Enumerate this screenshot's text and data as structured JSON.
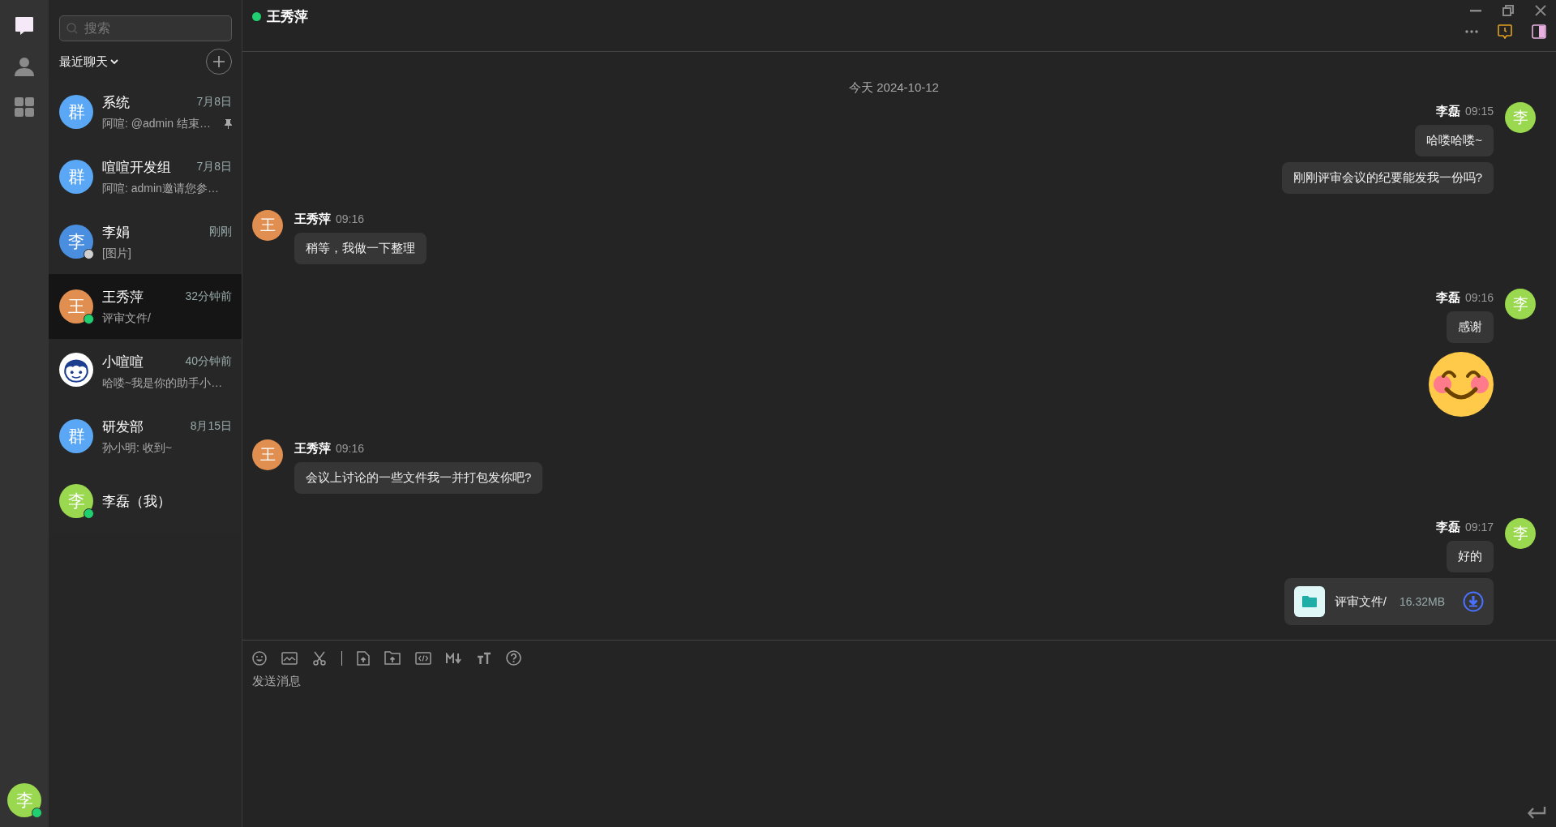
{
  "rail": {
    "items": [
      {
        "kind": "chat",
        "selected": true
      },
      {
        "kind": "contacts",
        "selected": false
      },
      {
        "kind": "apps",
        "selected": false
      }
    ],
    "me": {
      "text": "李",
      "color": "#9ad94f",
      "status_dot": {
        "color": "#20d070"
      }
    }
  },
  "sidebar": {
    "search": {
      "placeholder": "搜索"
    },
    "filter": "最近聊天",
    "conversations": [
      {
        "name": "系统",
        "time": "7月8日",
        "preview": "阿喧: @admin 结束…",
        "avatar": {
          "kind": "text",
          "text": "群",
          "color": "#5aa8f5"
        },
        "pinned": true,
        "selected": false
      },
      {
        "name": "喧喧开发组",
        "time": "7月8日",
        "preview": "阿喧: admin邀请您参…",
        "avatar": {
          "kind": "text",
          "text": "群",
          "color": "#5aa8f5"
        },
        "pinned": false,
        "selected": false
      },
      {
        "name": "李娟",
        "time": "刚刚",
        "preview": "[图片]",
        "avatar": {
          "kind": "text",
          "text": "李",
          "color": "#4a8ee0"
        },
        "status_dot": {
          "color": "#cfcfcf"
        },
        "pinned": false,
        "selected": false
      },
      {
        "name": "王秀萍",
        "time": "32分钟前",
        "preview": "评审文件/",
        "avatar": {
          "kind": "text",
          "text": "王",
          "color": "#e08f50"
        },
        "status_dot": {
          "color": "#20d070"
        },
        "pinned": false,
        "selected": true
      },
      {
        "name": "小喧喧",
        "time": "40分钟前",
        "preview": "哈喽~我是你的助手小…",
        "avatar": {
          "kind": "mascot"
        },
        "pinned": false,
        "selected": false
      },
      {
        "name": "研发部",
        "time": "8月15日",
        "preview": "孙小明: 收到~",
        "avatar": {
          "kind": "text",
          "text": "群",
          "color": "#5aa8f5"
        },
        "pinned": false,
        "selected": false
      },
      {
        "name": "李磊（我）",
        "avatar": {
          "kind": "text",
          "text": "李",
          "color": "#9ad94f"
        },
        "status_dot": {
          "color": "#20d070"
        },
        "pinned": false,
        "selected": false
      }
    ]
  },
  "chat": {
    "title": "王秀萍",
    "online": true,
    "messages": [
      {
        "kind": "date",
        "text": "今天 2024-10-12"
      },
      {
        "kind": "sent",
        "sender": "李磊",
        "time": "09:15",
        "avatar": {
          "text": "李",
          "color": "#9ad94f"
        },
        "items": [
          {
            "kind": "text",
            "text": "哈喽哈喽~"
          },
          {
            "kind": "text",
            "text": "刚刚评审会议的纪要能发我一份吗?"
          }
        ]
      },
      {
        "kind": "received",
        "sender": "王秀萍",
        "time": "09:16",
        "avatar": {
          "text": "王",
          "color": "#e08f50"
        },
        "items": [
          {
            "kind": "text",
            "text": "稍等，我做一下整理"
          }
        ]
      },
      {
        "kind": "sent",
        "sender": "李磊",
        "time": "09:16",
        "avatar": {
          "text": "李",
          "color": "#9ad94f"
        },
        "items": [
          {
            "kind": "text",
            "text": "感谢"
          },
          {
            "kind": "emoji"
          }
        ]
      },
      {
        "kind": "received",
        "sender": "王秀萍",
        "time": "09:16",
        "avatar": {
          "text": "王",
          "color": "#e08f50"
        },
        "items": [
          {
            "kind": "text",
            "text": "会议上讨论的一些文件我一并打包发你吧?"
          }
        ]
      },
      {
        "kind": "sent",
        "sender": "李磊",
        "time": "09:17",
        "avatar": {
          "text": "李",
          "color": "#9ad94f"
        },
        "items": [
          {
            "kind": "text",
            "text": "好的"
          },
          {
            "kind": "file",
            "name": "评审文件/",
            "size": "16.32MB"
          }
        ]
      }
    ],
    "composer": {
      "placeholder": "发送消息"
    }
  }
}
